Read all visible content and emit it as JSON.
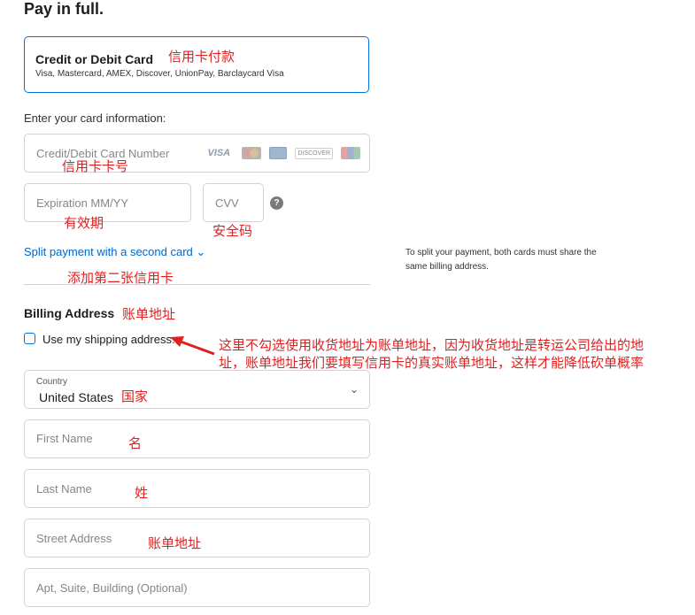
{
  "page": {
    "title": "Pay in full."
  },
  "payment_option": {
    "name": "Credit or Debit Card",
    "cards_line": "Visa, Mastercard, AMEX, Discover, UnionPay, Barclaycard Visa"
  },
  "card_info": {
    "heading": "Enter your card information:",
    "number_placeholder": "Credit/Debit Card Number",
    "card_brands": {
      "visa": "VISA",
      "discover": "DISCOVER"
    },
    "expiration_placeholder": "Expiration MM/YY",
    "cvv_placeholder": "CVV",
    "help_glyph": "?"
  },
  "split": {
    "link_label": "Split payment with a second card",
    "chevron": "⌄",
    "note": "To split your payment, both cards must share the same billing address."
  },
  "billing": {
    "heading": "Billing Address",
    "use_shipping_label": "Use my shipping address.",
    "country_label": "Country",
    "country_value": "United States",
    "first_name_placeholder": "First Name",
    "last_name_placeholder": "Last Name",
    "street_placeholder": "Street Address",
    "apt_placeholder": "Apt, Suite, Building (Optional)"
  },
  "annotations": {
    "credit_card_pay": "信用卡付款",
    "card_number": "信用卡卡号",
    "expiry": "有效期",
    "cvv": "安全码",
    "add_second_card": "添加第二张信用卡",
    "billing_address": "账单地址",
    "shipping_note_line1": "这里不勾选使用收货地址为账单地址，因为收货地址是转运公司给出的地",
    "shipping_note_line2": "址，账单地址我们要填写信用卡的真实账单地址，这样才能降低砍单概率",
    "country": "国家",
    "first_name": "名",
    "last_name": "姓",
    "street": "账单地址"
  },
  "colors": {
    "accent": "#0071e3",
    "annotation": "#e02020",
    "link": "#0066cc"
  }
}
